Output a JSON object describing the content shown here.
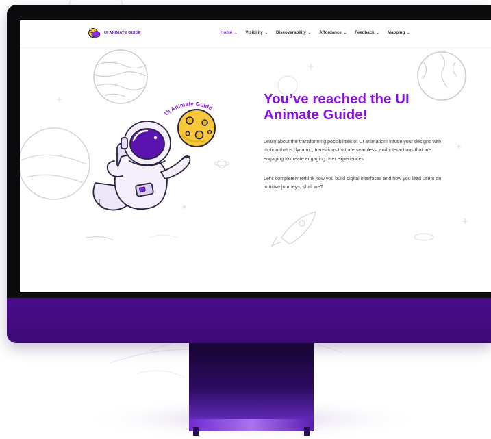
{
  "site": {
    "logo_text": "UI ANIMATE GUIDE"
  },
  "nav": {
    "items": [
      {
        "label": "Home",
        "active": true
      },
      {
        "label": "Visibility",
        "active": false
      },
      {
        "label": "Discoverability",
        "active": false
      },
      {
        "label": "Affordance",
        "active": false
      },
      {
        "label": "Feedback",
        "active": false
      },
      {
        "label": "Mapping",
        "active": false
      }
    ],
    "chevron": "⌄"
  },
  "hero": {
    "badge_text": "UI Animate Guide",
    "title": "You’ve reached the UI Animate Guide!",
    "paragraph_1": "Learn about the transforming possibilities of UI animation! Infuse your designs with motion that is dynamic, transitions that are seamless, and interactions that are engaging to create engaging user experiences.",
    "paragraph_2": "Let's completely rethink how you build digital interfaces and how you lead users on intuitive journeys, shall we?"
  },
  "colors": {
    "accent": "#8a12e0",
    "brand_purple": "#5b13b0",
    "monitor_chin": "#4a0d8a",
    "bezel": "#0b0b0e",
    "moon_yellow": "#f7c83a"
  },
  "icons": [
    "astronaut-illustration",
    "moon-icon",
    "planet-icon",
    "rocket-icon",
    "sparkle-icon",
    "logo-icon",
    "chevron-down-icon"
  ]
}
